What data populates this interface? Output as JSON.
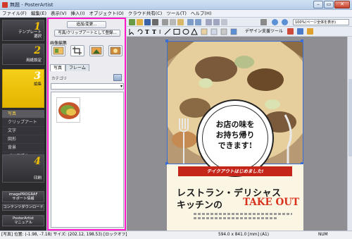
{
  "window": {
    "title": "無題 - PosterArtist",
    "min": "–",
    "max": "▭",
    "close": "✕"
  },
  "menu": [
    "ファイル(F)",
    "編集(E)",
    "表示(V)",
    "挿入(I)",
    "オブジェクト(O)",
    "クラウド共有(C)",
    "ツール(T)",
    "ヘルプ(H)"
  ],
  "steps": [
    {
      "num": "1",
      "label": "テンプレート\n選択"
    },
    {
      "num": "2",
      "label": "用紙設定"
    },
    {
      "num": "3",
      "label": "編集"
    },
    {
      "num": "4",
      "label": "印刷"
    }
  ],
  "step_sub": [
    "写真",
    "クリップアート",
    "文字",
    "図形",
    "背景",
    "パリアブル"
  ],
  "navlinks": [
    "imagePROGRAF\nサポート情報",
    "コンテンツダウンロード",
    "PosterArtist\nマニュアル"
  ],
  "panel": {
    "add_button": "追加/変更...",
    "register_button": "写真/クリップアートとして登録...",
    "section_label": "画像編集",
    "tabs": [
      "写真",
      "フレーム"
    ],
    "category_label": "カテゴリ"
  },
  "toolbar": {
    "design_tool": "デザイン支援ツール",
    "zoom_value": "100%(ページ全体を表示)"
  },
  "poster": {
    "circle_line1": "お店の味を",
    "circle_line2": "お持ち帰り",
    "circle_line3": "できます!",
    "ribbon": "テイクアウトはじめました!",
    "headline1": "レストラン・デリシャス",
    "headline2": "キッチンの",
    "takeout": "TAKE OUT"
  },
  "status": {
    "left": "[写真] 位置: (-1.98, -7.18) サイズ: (202.12, 198.53) [ロックオフ]",
    "size": "594.0 x 841.0 [mm] (A1)",
    "num": "NUM"
  },
  "colors": {
    "accent_magenta": "#ff19c8",
    "step_active": "#f2c200",
    "poster_red": "#c4261a"
  }
}
